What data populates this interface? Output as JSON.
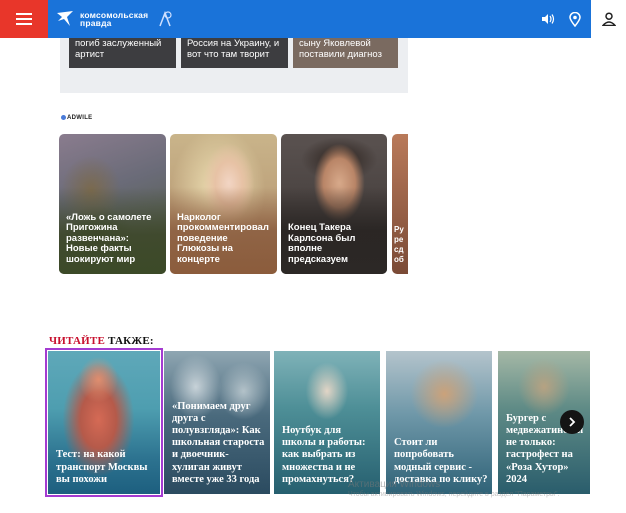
{
  "header": {
    "logo_line1": "комсомольская",
    "logo_line2": "правда",
    "icons": [
      "menu-icon",
      "speaker-icon",
      "location-pin-icon",
      "user-icon"
    ],
    "brand_color": "#1a73d9",
    "menu_color": "#e8362a"
  },
  "prev_news": [
    {
      "text_line1": "погиб заслуженный",
      "text_line2": "артист"
    },
    {
      "text_line1": "Россия на Украину, и",
      "text_line2": "вот что там творит"
    },
    {
      "text_line1": "сыну Яковлевой",
      "text_line2": "поставили диагноз"
    }
  ],
  "adwile": {
    "label": "ADWILE",
    "cards": [
      {
        "title": "«Ложь о самолете Пригожина развенчана»: Новые факты шокируют мир"
      },
      {
        "title": "Нарколог прокомментировал поведение Глюкозы на концерте"
      },
      {
        "title": "Конец Такера Карлсона был вполне предсказуем"
      },
      {
        "title": "Ру ре сд об"
      }
    ]
  },
  "read_also": {
    "label_red": "ЧИТАЙТЕ",
    "label_black": "ТАКЖЕ:",
    "stories": [
      {
        "title": "Тест: на какой транспорт Москвы вы похожи"
      },
      {
        "title": "«Понимаем друг друга с полувзгляда»: Как школьная староста и двоечник-хулиган живут вместе уже 33 года"
      },
      {
        "title": "Ноутбук для школы и работы: как выбрать из множества и не промахнуться?"
      },
      {
        "title": "Стоит ли попробовать модный сервис - доставка по клику?"
      },
      {
        "title": "Бургер с медвежатиной и не только: гастрофест на «Роза Хутор» 2024"
      }
    ]
  },
  "watermark": {
    "line1": "Активация Windows",
    "line2": "Чтобы активировать Windows, перейдите в раздел \"Параметры\"."
  }
}
